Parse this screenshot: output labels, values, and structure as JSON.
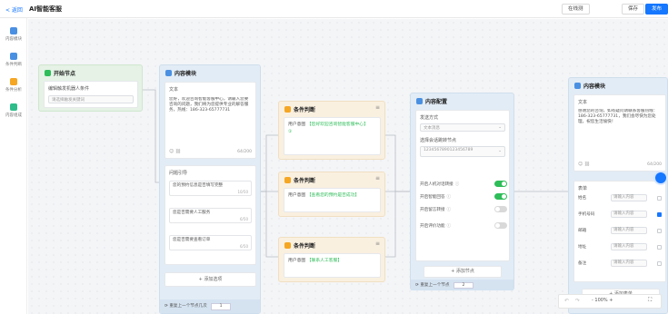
{
  "header": {
    "back_label": "< 返回",
    "title": "AI智能客服",
    "btn_test": "在线测",
    "btn_save": "保存",
    "btn_publish": "发布"
  },
  "sidebar": {
    "items": [
      {
        "label": "内容模块",
        "color": "#4a90e2"
      },
      {
        "label": "条件判断",
        "color": "#4a90e2"
      },
      {
        "label": "条件分析",
        "color": "#f5a623"
      },
      {
        "label": "内容组成",
        "color": "#2ebd8a"
      }
    ]
  },
  "start_node": {
    "title": "开始节点",
    "label": "编辑触发机器人条件",
    "placeholder": "请选择触发关键词"
  },
  "content_node_1": {
    "title": "内容模块",
    "section_label": "文本",
    "text": "您好，欢迎咨询智能客服中心，请输入您要咨询的问题，我们将为您提供专业的解答服务，热线：186-323-65777731",
    "count": "64/200",
    "list_label": "问题引导",
    "items": [
      {
        "text": "您的预约信息是否填写完整",
        "count": "10/50"
      },
      {
        "text": "您是否需要人工服务",
        "count": "6/50"
      },
      {
        "text": "您是否需要查看订单",
        "count": "6/50"
      }
    ],
    "add_label": "+ 添加选项",
    "footer_label": "重复上一个节点几次",
    "footer_value": "1"
  },
  "cond_nodes": [
    {
      "title": "条件判断",
      "prefix": "用户意图",
      "tag": "【您好欢迎咨询智能客服中心】",
      "extra": "①"
    },
    {
      "title": "条件判断",
      "prefix": "用户意图",
      "tag": "【查看您的预约是否成功】",
      "extra": ""
    },
    {
      "title": "条件判断",
      "prefix": "用户意图",
      "tag": "【联系人工客服】",
      "extra": ""
    }
  ],
  "content_config": {
    "title": "内容配置",
    "select_label": "发送方式",
    "select_value": "文本消息",
    "field_label": "选择会话跳转节点",
    "field_value": "1234567890123456789",
    "toggles": [
      {
        "label": "开启人机对话转接",
        "on": true
      },
      {
        "label": "开启智能回答",
        "on": true
      },
      {
        "label": "开启留言转接",
        "on": false
      },
      {
        "label": "开启评价功能",
        "on": false
      }
    ],
    "add_label": "+ 添加节点",
    "footer_label": "重复上一个节点",
    "footer_value": "2"
  },
  "content_node_2": {
    "title": "内容模块",
    "section_label": "文本",
    "text": "感谢您的咨询，如有疑问请联系客服热线：186-323-65777731，我们会尽快为您处理，祝您生活愉快！",
    "count": "64/200",
    "form_label": "表单",
    "rows": [
      {
        "label": "姓名",
        "placeholder": "请输入内容",
        "checked": false
      },
      {
        "label": "手机号码",
        "placeholder": "请输入内容",
        "checked": true
      },
      {
        "label": "邮箱",
        "placeholder": "请输入内容",
        "checked": false
      },
      {
        "label": "地址",
        "placeholder": "请输入内容",
        "checked": false
      },
      {
        "label": "备注",
        "placeholder": "请输入内容",
        "checked": false
      }
    ],
    "add_label": "+ 添加表单"
  },
  "tools": {
    "zoom_label": "- 100% +",
    "fit_label": "⛶"
  }
}
